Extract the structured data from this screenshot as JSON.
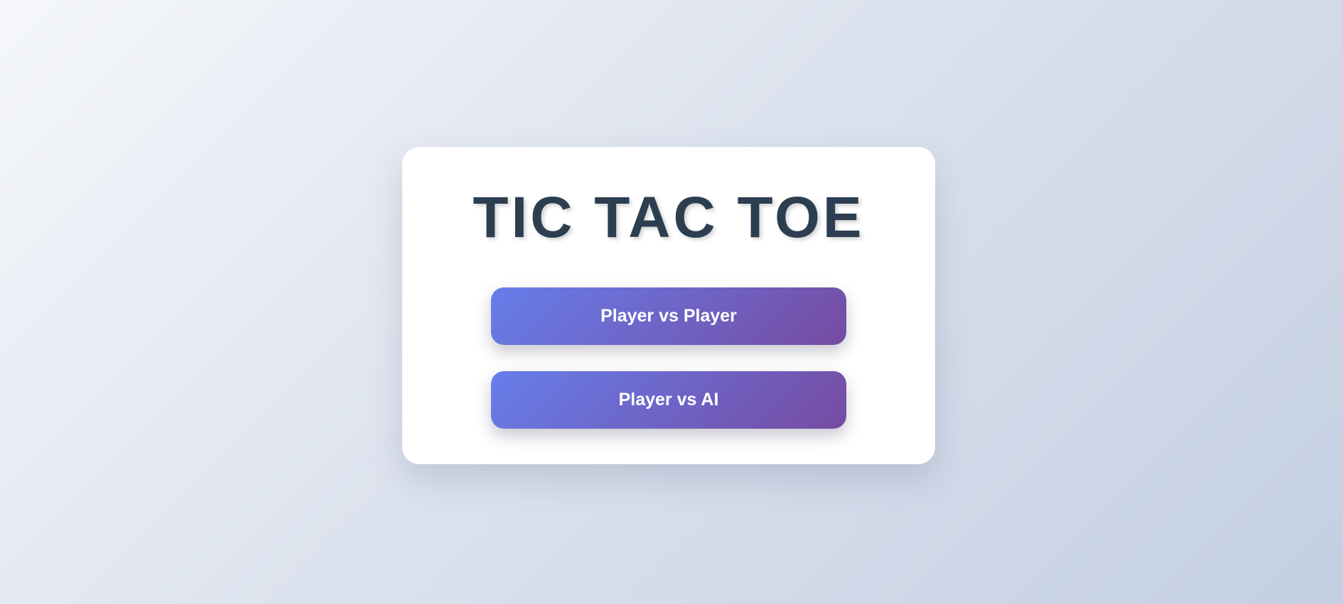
{
  "menu": {
    "title": "TIC TAC TOE",
    "buttons": [
      {
        "label": "Player vs Player"
      },
      {
        "label": "Player vs AI"
      }
    ]
  },
  "colors": {
    "background_start": "#f5f7fa",
    "background_end": "#c3cfe2",
    "title": "#2c3e50",
    "button_gradient_start": "#667eea",
    "button_gradient_end": "#764ba2",
    "button_text": "#ffffff",
    "card": "#ffffff"
  }
}
